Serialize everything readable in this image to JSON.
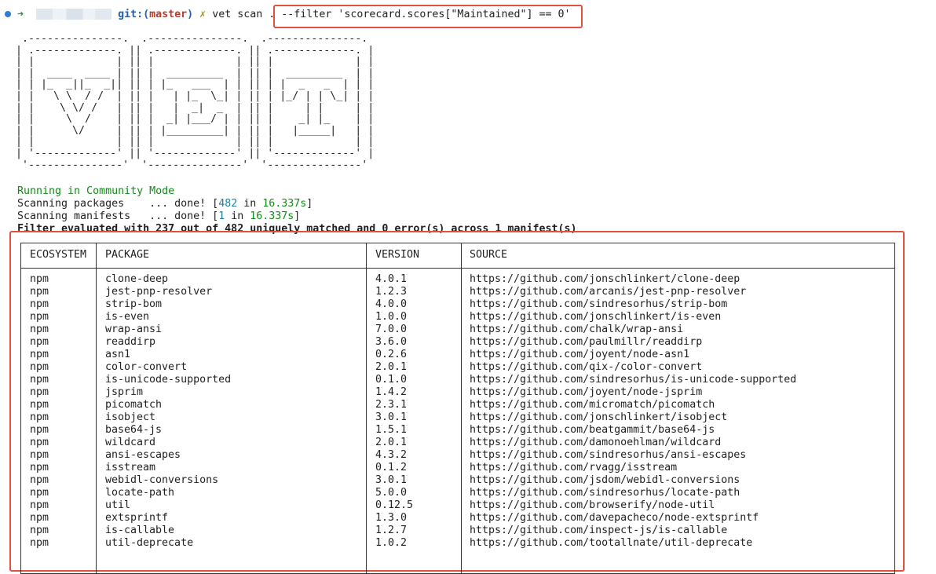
{
  "prompt": {
    "git_label": "git:(",
    "branch": "master",
    "close_paren": ")",
    "command": "vet scan .",
    "filter_arg": "--filter 'scorecard.scores[\"Maintained\"] == 0'"
  },
  "banner_art": " .---------------.  .---------------.  .---------------.\n| .-------------. || .-------------. || .-------------. |\n| |             | || |             | || |             | |\n| |  ____  ____ | || |  _________  | || |  _________  | |\n| | |_  _||_  _|| || | |_   ___  | | || | |  _   _  | | |\n| |   \\ \\  / /  | || |   | |_  \\_| | || | |_/ | | \\_| | |\n| |    \\ \\/ /   | || |   |  _|  _  | || |     | |     | |\n| |     \\  /    | || |  _| |___/ | | || |    _| |_    | |\n| |      \\/     | || | |_________| | || |   |_____|   | |\n| |             | || |             | || |             | |\n| '-------------' || '-------------' || '-------------' |\n '---------------'  '---------------'  '---------------'",
  "status": {
    "mode": "Running in Community Mode",
    "packages_label": "Scanning packages    ... done! [",
    "packages_count": "482",
    "packages_in": " in ",
    "packages_time": "16.337s",
    "packages_close": "]",
    "manifests_label": "Scanning manifests   ... done! [",
    "manifests_count": "1",
    "manifests_in": " in ",
    "manifests_time": "16.337s",
    "manifests_close": "]",
    "filter_summary": "Filter evaluated with 237 out of 482 uniquely matched and 0 error(s) across 1 manifest(s)"
  },
  "table": {
    "headers": [
      "ECOSYSTEM",
      "PACKAGE",
      "VERSION",
      "SOURCE"
    ],
    "rows": [
      [
        "npm",
        "clone-deep",
        "4.0.1",
        "https://github.com/jonschlinkert/clone-deep"
      ],
      [
        "npm",
        "jest-pnp-resolver",
        "1.2.3",
        "https://github.com/arcanis/jest-pnp-resolver"
      ],
      [
        "npm",
        "strip-bom",
        "4.0.0",
        "https://github.com/sindresorhus/strip-bom"
      ],
      [
        "npm",
        "is-even",
        "1.0.0",
        "https://github.com/jonschlinkert/is-even"
      ],
      [
        "npm",
        "wrap-ansi",
        "7.0.0",
        "https://github.com/chalk/wrap-ansi"
      ],
      [
        "npm",
        "readdirp",
        "3.6.0",
        "https://github.com/paulmillr/readdirp"
      ],
      [
        "npm",
        "asn1",
        "0.2.6",
        "https://github.com/joyent/node-asn1"
      ],
      [
        "npm",
        "color-convert",
        "2.0.1",
        "https://github.com/qix-/color-convert"
      ],
      [
        "npm",
        "is-unicode-supported",
        "0.1.0",
        "https://github.com/sindresorhus/is-unicode-supported"
      ],
      [
        "npm",
        "jsprim",
        "1.4.2",
        "https://github.com/joyent/node-jsprim"
      ],
      [
        "npm",
        "picomatch",
        "2.3.1",
        "https://github.com/micromatch/picomatch"
      ],
      [
        "npm",
        "isobject",
        "3.0.1",
        "https://github.com/jonschlinkert/isobject"
      ],
      [
        "npm",
        "base64-js",
        "1.5.1",
        "https://github.com/beatgammit/base64-js"
      ],
      [
        "npm",
        "wildcard",
        "2.0.1",
        "https://github.com/damonoehlman/wildcard"
      ],
      [
        "npm",
        "ansi-escapes",
        "4.3.2",
        "https://github.com/sindresorhus/ansi-escapes"
      ],
      [
        "npm",
        "isstream",
        "0.1.2",
        "https://github.com/rvagg/isstream"
      ],
      [
        "npm",
        "webidl-conversions",
        "3.0.1",
        "https://github.com/jsdom/webidl-conversions"
      ],
      [
        "npm",
        "locate-path",
        "5.0.0",
        "https://github.com/sindresorhus/locate-path"
      ],
      [
        "npm",
        "util",
        "0.12.5",
        "https://github.com/browserify/node-util"
      ],
      [
        "npm",
        "extsprintf",
        "1.3.0",
        "https://github.com/davepacheco/node-extsprintf"
      ],
      [
        "npm",
        "is-callable",
        "1.2.7",
        "https://github.com/inspect-js/is-callable"
      ],
      [
        "npm",
        "util-deprecate",
        "1.0.2",
        "https://github.com/tootallnate/util-deprecate"
      ]
    ]
  },
  "colors": {
    "highlight": "#e0523f",
    "mode_text": "#128a1a",
    "count_text": "#1f7fa8"
  }
}
